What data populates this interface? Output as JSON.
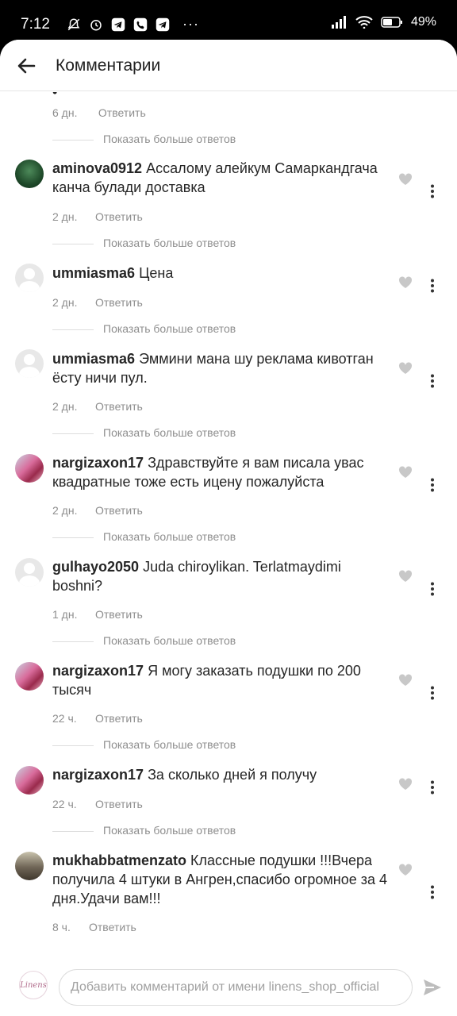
{
  "status_bar": {
    "time": "7:12",
    "battery": "49%",
    "icons": [
      "muted-notifications-icon",
      "alarm-icon",
      "telegram-icon",
      "phone-icon",
      "telegram-icon",
      "more-dots"
    ],
    "right_icons": [
      "signal-icon",
      "wifi-icon",
      "battery-icon"
    ]
  },
  "header": {
    "title": "Комментарии",
    "back_icon": "back-arrow-icon"
  },
  "labels": {
    "reply": "Ответить",
    "more_replies": "Показать больше ответов"
  },
  "top_partial": {
    "age": "6 дн."
  },
  "comments": [
    {
      "username": "aminova0912",
      "text": "Ассалому алейкум Самаркандгача канча булади доставка",
      "age": "2 дн.",
      "avatar": "photo"
    },
    {
      "username": "ummiasma6",
      "text": "Цена",
      "age": "2 дн.",
      "avatar": "default"
    },
    {
      "username": "ummiasma6",
      "text": "Эммини мана шу реклама кивотган ёсту ничи пул.",
      "age": "2 дн.",
      "avatar": "default"
    },
    {
      "username": "nargizaxon17",
      "text": "Здравствуйте я вам писала увас квадратные  тоже есть ицену пожалуйста",
      "age": "2 дн.",
      "avatar": "photo"
    },
    {
      "username": "gulhayo2050",
      "text": "Juda chiroylikan. Terlatmaydimi boshni?",
      "age": "1 дн.",
      "avatar": "default"
    },
    {
      "username": "nargizaxon17",
      "text": "Я могу заказать подушки по 200 тысяч",
      "age": "22 ч.",
      "avatar": "photo"
    },
    {
      "username": "nargizaxon17",
      "text": "За сколько дней я получу",
      "age": "22 ч.",
      "avatar": "photo"
    },
    {
      "username": "mukhabbatmenzato",
      "text": "Классные подушки !!!Вчера получила 4 штуки в Ангрен,спасибо огромное за 4 дня.Удачи вам!!!",
      "age": "8 ч.",
      "avatar": "photo"
    }
  ],
  "composer": {
    "placeholder": "Добавить комментарий от имени linens_shop_official",
    "avatar_logo": "Linens",
    "send_icon": "send-icon"
  }
}
